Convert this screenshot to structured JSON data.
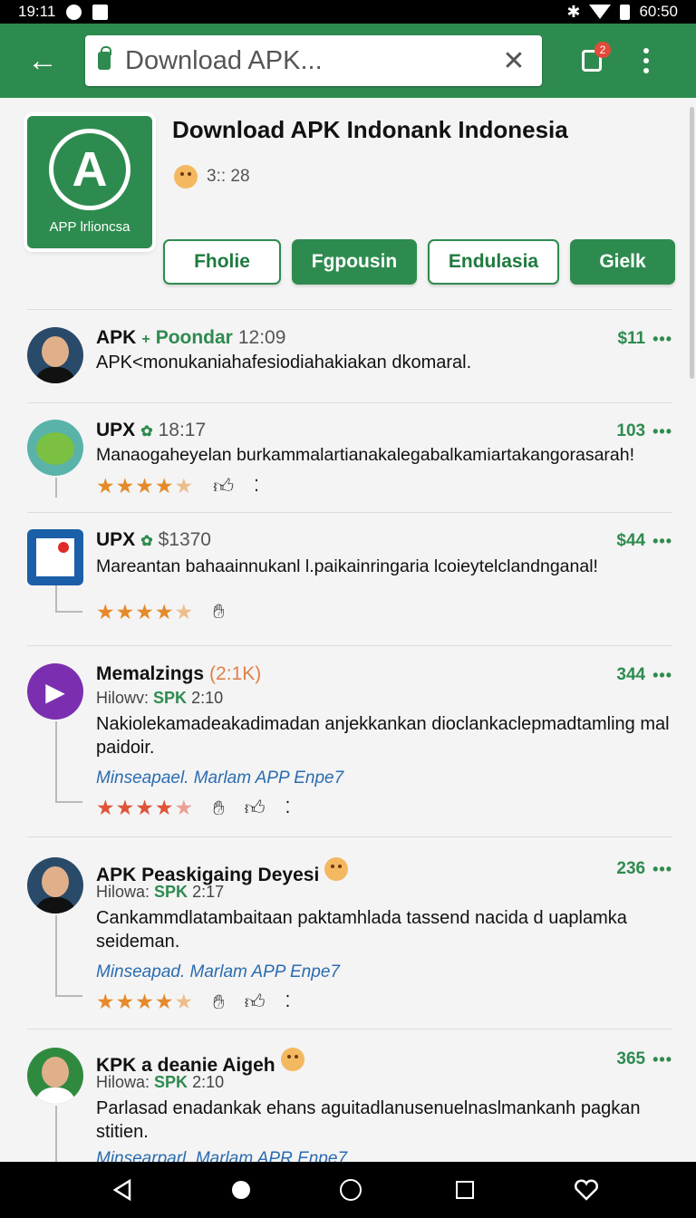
{
  "status_bar": {
    "time": "19:11",
    "clock_right": "60:50"
  },
  "browser": {
    "url_text": "Download APK...",
    "tab_count": "2"
  },
  "app": {
    "title": "Download APK Indonank Indonesia",
    "icon_label": "APP lrlioncsa",
    "icon_letter": "A",
    "meta": "3:: 28"
  },
  "actions": [
    "Fholie",
    "Fgpousin",
    "Endulasia",
    "Gielk"
  ],
  "reviews": [
    {
      "name": "APK",
      "sep": "+",
      "tag": "Poondar",
      "time": "12:09",
      "right": "$11",
      "text": "APK<monukaniahafesiodiahakiakan dkomaral."
    },
    {
      "name": "UPX",
      "sep": "✿",
      "time": "18:17",
      "right": "103",
      "text": "Manaogaheyelan burkammalartianakalegabalkamiartakangorasarah!"
    },
    {
      "name": "UPX",
      "sep": "✿",
      "time": "$1370",
      "right": "$44",
      "text": "Mareantan bahaainnukanl l.paikainringaria lcoieytelclandnganal!"
    },
    {
      "name": "Memalzings",
      "count": "(2:1K)",
      "sub_prefix": "Hilowv:",
      "sub_tag": "SPK",
      "sub_time": "2:10",
      "right": "344",
      "text": "Nakiolekamadeakadimadan anjekkankan dioclankaclepmadtamling mal paidoir.",
      "link": "Minseapael. Marlam APP Enpe7"
    },
    {
      "name": "APK Peaskigaing Deyesi",
      "sub_prefix": "Hilowa:",
      "sub_tag": "SPK",
      "sub_time": "2:17",
      "right": "236",
      "text": "Cankammdlatambaitaan paktamhlada tassend nacida d uaplamka seideman.",
      "link": "Minseapad. Marlam APP Enpe7"
    },
    {
      "name": "KPK a deanie Aigeh",
      "sub_prefix": "Hilowa:",
      "sub_tag": "SPK",
      "sub_time": "2:10",
      "right": "365",
      "text": "Parlasad enadankak ehans aguitadlanusenuelnaslmankanh pagkan stitien.",
      "link": "Minsearparl. Marlam APR Enpe7"
    }
  ],
  "more_label": "•••",
  "ratings": [
    4.5,
    4.5,
    4.5,
    4.5
  ]
}
